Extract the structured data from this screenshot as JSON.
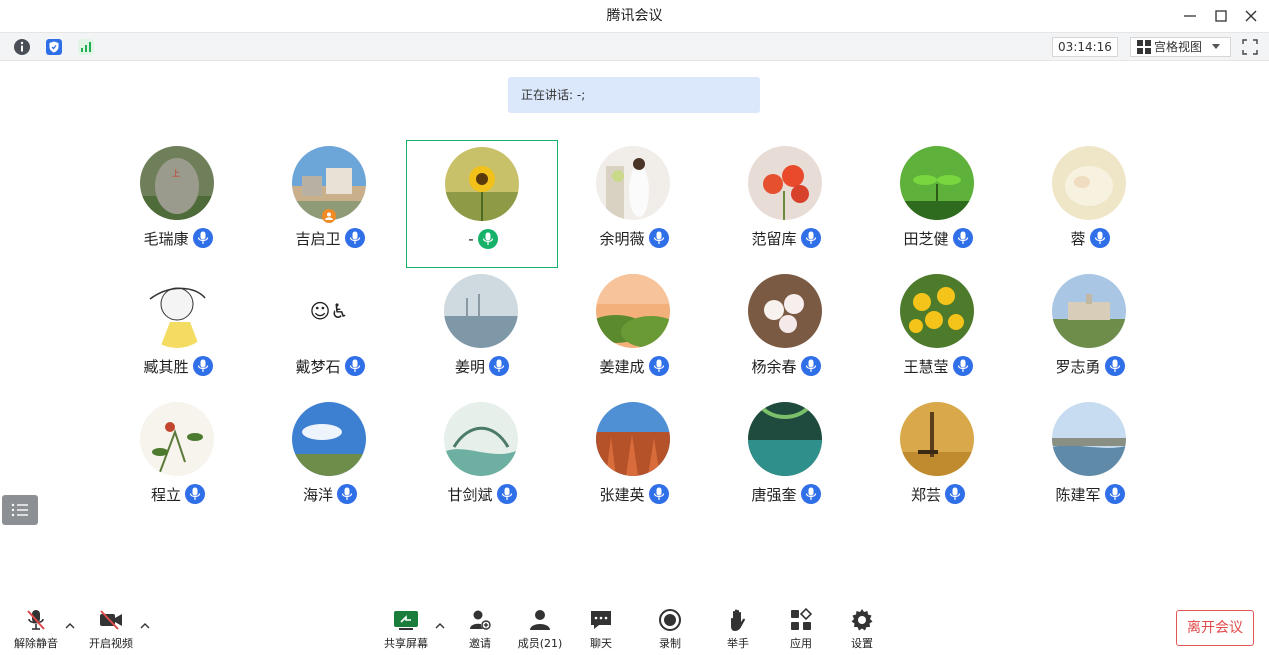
{
  "window": {
    "title": "腾讯会议"
  },
  "infobar": {
    "timer": "03:14:16",
    "view_label": "宫格视图"
  },
  "speaking": {
    "text": "正在讲话: -;"
  },
  "participants": [
    {
      "name": "毛瑞康",
      "mic": "active"
    },
    {
      "name": "吉启卫",
      "mic": "active",
      "host": true
    },
    {
      "name": "-",
      "mic": "speaking",
      "highlighted": true
    },
    {
      "name": "余明薇",
      "mic": "active"
    },
    {
      "name": "范留库",
      "mic": "active"
    },
    {
      "name": "田芝健",
      "mic": "active"
    },
    {
      "name": "蓉",
      "mic": "active"
    },
    {
      "name": "臧其胜",
      "mic": "active"
    },
    {
      "name": "戴梦石",
      "mic": "active",
      "avatar_text": "☺♿"
    },
    {
      "name": "姜明",
      "mic": "active"
    },
    {
      "name": "姜建成",
      "mic": "active"
    },
    {
      "name": "杨余春",
      "mic": "active"
    },
    {
      "name": "王慧莹",
      "mic": "active"
    },
    {
      "name": "罗志勇",
      "mic": "active"
    },
    {
      "name": "程立",
      "mic": "active"
    },
    {
      "name": "海洋",
      "mic": "active"
    },
    {
      "name": "甘剑斌",
      "mic": "active"
    },
    {
      "name": "张建英",
      "mic": "active"
    },
    {
      "name": "唐强奎",
      "mic": "active"
    },
    {
      "name": "郑芸",
      "mic": "active"
    },
    {
      "name": "陈建军",
      "mic": "active"
    }
  ],
  "toolbar": {
    "unmute": "解除静音",
    "start_video": "开启视频",
    "share_screen": "共享屏幕",
    "invite": "邀请",
    "members": "成员(21)",
    "chat": "聊天",
    "record": "录制",
    "raise_hand": "举手",
    "apps": "应用",
    "settings": "设置",
    "leave": "离开会议"
  },
  "colors": {
    "accent_blue": "#2f6fe8",
    "speaking_green": "#17b26a",
    "leave_red": "#e14a4a",
    "banner_bg": "#dbe8fb"
  }
}
